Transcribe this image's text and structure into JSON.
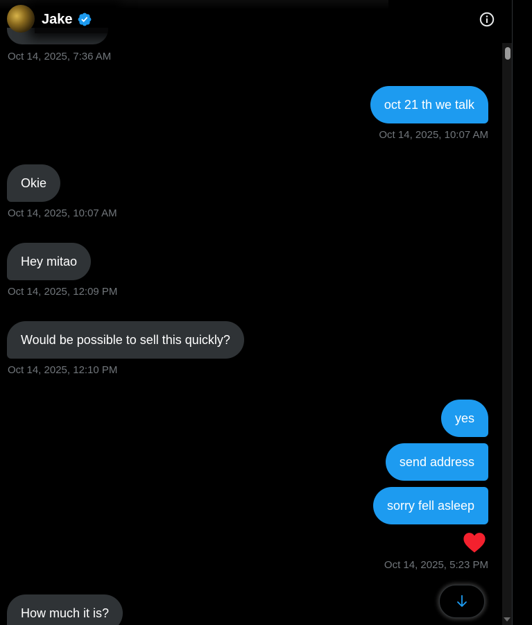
{
  "header": {
    "name": "Jake",
    "verified_icon": "verified-badge-icon",
    "info_icon": "info-icon",
    "verified_color": "#1d9bf0"
  },
  "messages": [
    {
      "side": "received",
      "text": "",
      "timestamp": "Oct 14, 2025, 7:36 AM"
    },
    {
      "side": "sent",
      "text": "oct 21 th we talk",
      "timestamp": "Oct 14, 2025, 10:07 AM"
    },
    {
      "side": "received",
      "text": "Okie",
      "timestamp": "Oct 14, 2025, 10:07 AM"
    },
    {
      "side": "received",
      "text": "Hey mitao",
      "timestamp": "Oct 14, 2025, 12:09 PM"
    },
    {
      "side": "received",
      "text": "Would be possible to sell this quickly?",
      "timestamp": "Oct 14, 2025, 12:10 PM"
    },
    {
      "side": "sent",
      "text": "yes",
      "timestamp": ""
    },
    {
      "side": "sent",
      "text": "send address",
      "timestamp": ""
    },
    {
      "side": "sent",
      "text": "sorry fell asleep",
      "timestamp": "Oct 14, 2025, 5:23 PM",
      "reaction": "heart-icon"
    },
    {
      "side": "received",
      "text": "How much it is?",
      "timestamp": ""
    }
  ],
  "colors": {
    "sent_bubble": "#1d9bf0",
    "received_bubble": "#2f3336",
    "timestamp": "#71767b",
    "reaction_heart": "#f91880"
  },
  "jump_button_icon": "arrow-down-icon"
}
